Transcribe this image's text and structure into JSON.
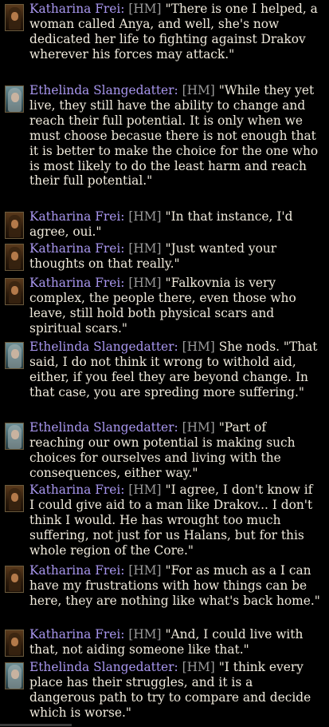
{
  "messages": [
    {
      "speaker": "Katharina Frei:",
      "tag": "[HM]",
      "text": "\"There is one I helped, a woman called Anya, and well, she's now dedicated her life to fighting against Drakov wherever his forces may attack.\"",
      "avatar": "katharina-portrait"
    },
    {
      "speaker": "Ethelinda Slangedatter:",
      "tag": "[HM]",
      "text": "\"While they yet live, they still have the ability to change and reach their full potential. It is only when we must choose becasue there is not enough that it is better to make the choice for the one who is most likely to do the least harm and reach their full potential.\"",
      "avatar": "ethelinda-portrait"
    },
    {
      "speaker": "Katharina Frei:",
      "tag": "[HM]",
      "text": "\"In that instance, I'd agree, oui.\"",
      "avatar": "katharina-portrait"
    },
    {
      "speaker": "Katharina Frei:",
      "tag": "[HM]",
      "text": "\"Just wanted your thoughts on that really.\"",
      "avatar": "katharina-portrait"
    },
    {
      "speaker": "Katharina Frei:",
      "tag": "[HM]",
      "text": "\"Falkovnia is very complex, the people there, even those who leave, still hold both physical scars and spiritual scars.\"",
      "avatar": "katharina-portrait"
    },
    {
      "speaker": "Ethelinda Slangedatter:",
      "tag": "[HM]",
      "text": "She nods. \"That said, I do not think it wrong to withold aid, either, if you feel they are beyond change. In that case, you are spreding more suffering.\"",
      "avatar": "ethelinda-portrait"
    },
    {
      "speaker": "Ethelinda Slangedatter:",
      "tag": "[HM]",
      "text": "\"Part of reaching our own potential is making such choices for ourselves and living with the consequences, either way.\"",
      "avatar": "ethelinda-portrait"
    },
    {
      "speaker": "Katharina Frei:",
      "tag": "[HM]",
      "text": "\"I agree, I don't know if I could give aid to a man like Drakov... I don't think I would. He has wrought too much suffering, not just for us Halans, but for this whole region of the Core.\"",
      "avatar": "katharina-portrait"
    },
    {
      "speaker": "Katharina Frei:",
      "tag": "[HM]",
      "text": "\"For as much as a I can have my frustrations with how things can be here, they are nothing like what's back home.\"",
      "avatar": "katharina-portrait"
    },
    {
      "speaker": "Katharina Frei:",
      "tag": "[HM]",
      "text": "\"And, I could live with that, not aiding someone like that.\"",
      "avatar": "katharina-portrait"
    },
    {
      "speaker": "Ethelinda Slangedatter:",
      "tag": "[HM]",
      "text": "\"I think every place has their struggles, and it is a dangerous path to try to compare and decide which is worse.\"",
      "avatar": "ethelinda-portrait"
    }
  ],
  "colors": {
    "background": "#000000",
    "speaker": "#a896ee",
    "tag": "#9a9a9a",
    "text": "#f0eadc"
  }
}
